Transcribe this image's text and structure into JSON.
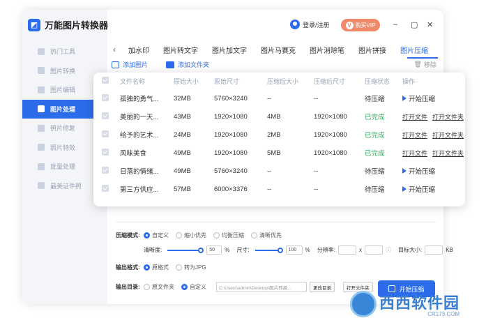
{
  "app": {
    "title": "万能图片转换器",
    "user_label": "登录/注册",
    "vip_label": "购买VIP",
    "win_min": "–",
    "win_max": "▢",
    "win_close": "✕"
  },
  "sidebar": {
    "items": [
      {
        "label": "热门工具",
        "active": false
      },
      {
        "label": "图片转换",
        "active": false
      },
      {
        "label": "图片编辑",
        "active": false
      },
      {
        "label": "图片处理",
        "active": true
      },
      {
        "label": "照片修复",
        "active": false
      },
      {
        "label": "照片特效",
        "active": false
      },
      {
        "label": "批量处理",
        "active": false
      },
      {
        "label": "最美证件照",
        "active": false
      }
    ]
  },
  "tabs": {
    "back": "‹",
    "items": [
      "加水印",
      "图片转文字",
      "图片加文字",
      "图片马赛克",
      "图片消除笔",
      "图片拼接",
      "图片压缩"
    ],
    "active": "图片压缩"
  },
  "actions": {
    "add_image": "添加图片",
    "add_folder": "添加文件夹",
    "remove": "移除"
  },
  "table": {
    "headers": [
      "文件名称",
      "原始大小",
      "原始尺寸",
      "压缩后大小",
      "压缩后尺寸",
      "压缩状态",
      "操作"
    ],
    "rows": [
      {
        "name": "孤独的勇气...",
        "size": "32MB",
        "dims": "5760×3240",
        "csize": "--",
        "cdims": "--",
        "status": "待压缩",
        "done": false
      },
      {
        "name": "美丽的一天...",
        "size": "43MB",
        "dims": "1920×1080",
        "csize": "4MB",
        "cdims": "1920×1080",
        "status": "已完成",
        "done": true
      },
      {
        "name": "给予的艺术...",
        "size": "24MB",
        "dims": "1920×1080",
        "csize": "2MB",
        "cdims": "1920×1080",
        "status": "已完成",
        "done": true
      },
      {
        "name": "风味美食",
        "size": "49MB",
        "dims": "1920×1080",
        "csize": "5MB",
        "cdims": "1920×1080",
        "status": "已完成",
        "done": true
      },
      {
        "name": "日落的情绪...",
        "size": "49MB",
        "dims": "5760×3240",
        "csize": "--",
        "cdims": "--",
        "status": "待压缩",
        "done": false
      },
      {
        "name": "第三方供应...",
        "size": "57MB",
        "dims": "6000×3376",
        "csize": "--",
        "cdims": "--",
        "status": "待压缩",
        "done": false
      }
    ],
    "op_start": "开始压缩",
    "op_open_file": "打开文件",
    "op_open_folder": "打开文件夹"
  },
  "settings": {
    "mode_label": "压缩模式:",
    "modes": [
      "自定义",
      "缩小优先",
      "均衡压缩",
      "清晰优先"
    ],
    "clarity_label": "清晰度:",
    "clarity_value": "50",
    "pct": "%",
    "size_label": "尺寸:",
    "size_value": "100",
    "resolution_label": "分辨率:",
    "x": "x",
    "target_label": "目标大小:",
    "kb": "KB",
    "format_label": "输出格式:",
    "formats": [
      "原格式",
      "转为JPG"
    ],
    "dir_label": "输出目录:",
    "dirs": [
      "原文件夹",
      "自定义"
    ],
    "path": "C:\\Users\\admin\\Desktop\\图片转换...",
    "change_dir": "更改目录",
    "open_folder": "打开文件夹",
    "start": "开始压缩"
  },
  "watermark": {
    "main": "西西软件园",
    "sub": "CR173.COM"
  },
  "colors": {
    "accent": "#2c6bea",
    "done": "#2bb05a",
    "vip": "#f08a6a"
  }
}
